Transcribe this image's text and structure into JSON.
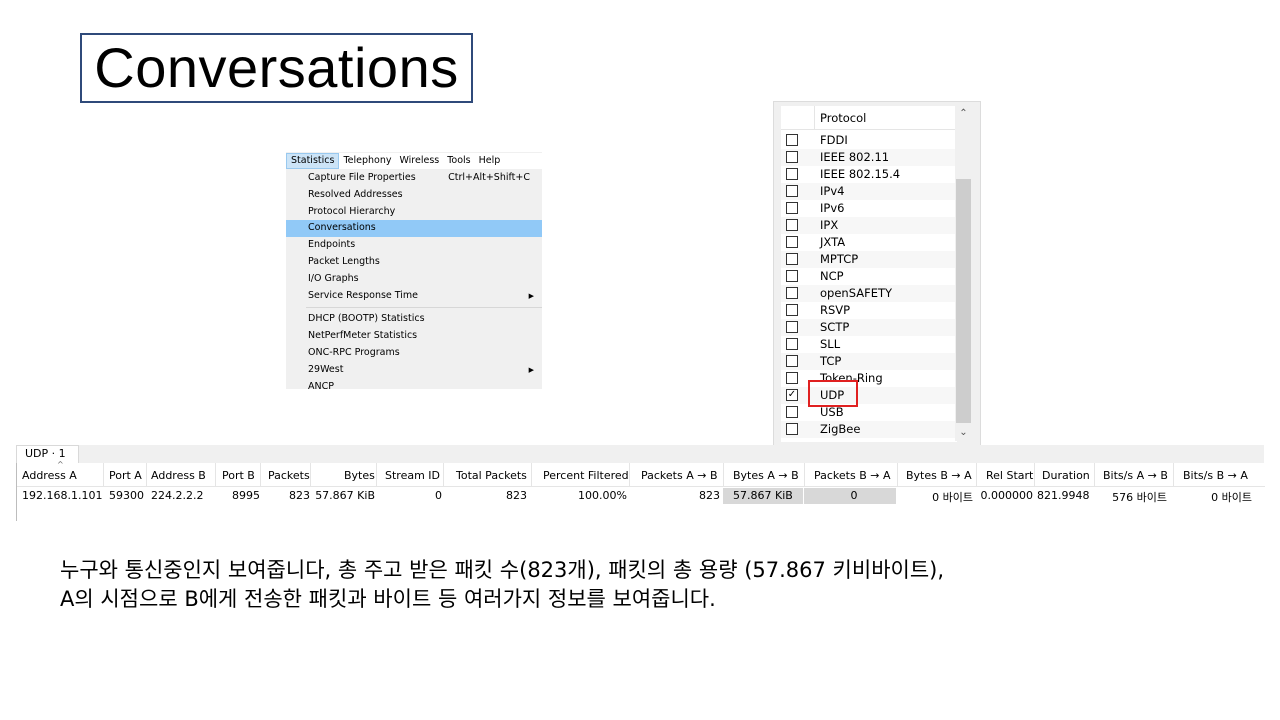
{
  "title": "Conversations",
  "menu": {
    "menubar": [
      "Statistics",
      "Telephony",
      "Wireless",
      "Tools",
      "Help"
    ],
    "items": [
      {
        "label": "Capture File Properties",
        "shortcut": "Ctrl+Alt+Shift+C"
      },
      {
        "label": "Resolved Addresses"
      },
      {
        "label": "Protocol Hierarchy"
      },
      {
        "label": "Conversations",
        "highlighted": true
      },
      {
        "label": "Endpoints"
      },
      {
        "label": "Packet Lengths"
      },
      {
        "label": "I/O Graphs"
      },
      {
        "label": "Service Response Time",
        "submenu": true
      }
    ],
    "items2": [
      {
        "label": "DHCP (BOOTP) Statistics"
      },
      {
        "label": "NetPerfMeter Statistics"
      },
      {
        "label": "ONC-RPC Programs"
      },
      {
        "label": "29West",
        "submenu": true
      },
      {
        "label": "ANCP"
      }
    ]
  },
  "protocol_panel": {
    "header": "Protocol",
    "rows": [
      {
        "name": "FDDI",
        "checked": false
      },
      {
        "name": "IEEE 802.11",
        "checked": false
      },
      {
        "name": "IEEE 802.15.4",
        "checked": false
      },
      {
        "name": "IPv4",
        "checked": false
      },
      {
        "name": "IPv6",
        "checked": false
      },
      {
        "name": "IPX",
        "checked": false
      },
      {
        "name": "JXTA",
        "checked": false
      },
      {
        "name": "MPTCP",
        "checked": false
      },
      {
        "name": "NCP",
        "checked": false
      },
      {
        "name": "openSAFETY",
        "checked": false
      },
      {
        "name": "RSVP",
        "checked": false
      },
      {
        "name": "SCTP",
        "checked": false
      },
      {
        "name": "SLL",
        "checked": false
      },
      {
        "name": "TCP",
        "checked": false
      },
      {
        "name": "Token-Ring",
        "checked": false
      },
      {
        "name": "UDP",
        "checked": true
      },
      {
        "name": "USB",
        "checked": false
      },
      {
        "name": "ZigBee",
        "checked": false
      }
    ],
    "scroll_up_icon": "chevron-up-icon",
    "scroll_down_icon": "chevron-down-icon"
  },
  "conversation": {
    "tab_label": "UDP · 1",
    "columns": [
      "Address A",
      "Port A",
      "Address B",
      "Port B",
      "Packets",
      "Bytes",
      "Stream ID",
      "Total Packets",
      "Percent Filtered",
      "Packets A → B",
      "Bytes A → B",
      "Packets B → A",
      "Bytes B → A",
      "Rel Start",
      "Duration",
      "Bits/s A → B",
      "Bits/s B → A"
    ],
    "row": [
      "192.168.1.101",
      "59300",
      "224.2.2.2",
      "8995",
      "823",
      "57.867 KiB",
      "0",
      "823",
      "100.00%",
      "823",
      "57.867 KiB",
      "0",
      "0 바이트",
      "0.000000",
      "821.9948",
      "576 바이트",
      "0 바이트"
    ]
  },
  "caption": {
    "line1": "누구와 통신중인지 보여줍니다, 총 주고 받은 패킷 수(823개), 패킷의 총 용량 (57.867 키비바이트),",
    "line2": "A의 시점으로 B에게 전송한 패킷과 바이트 등 여러가지 정보를 보여줍니다."
  }
}
